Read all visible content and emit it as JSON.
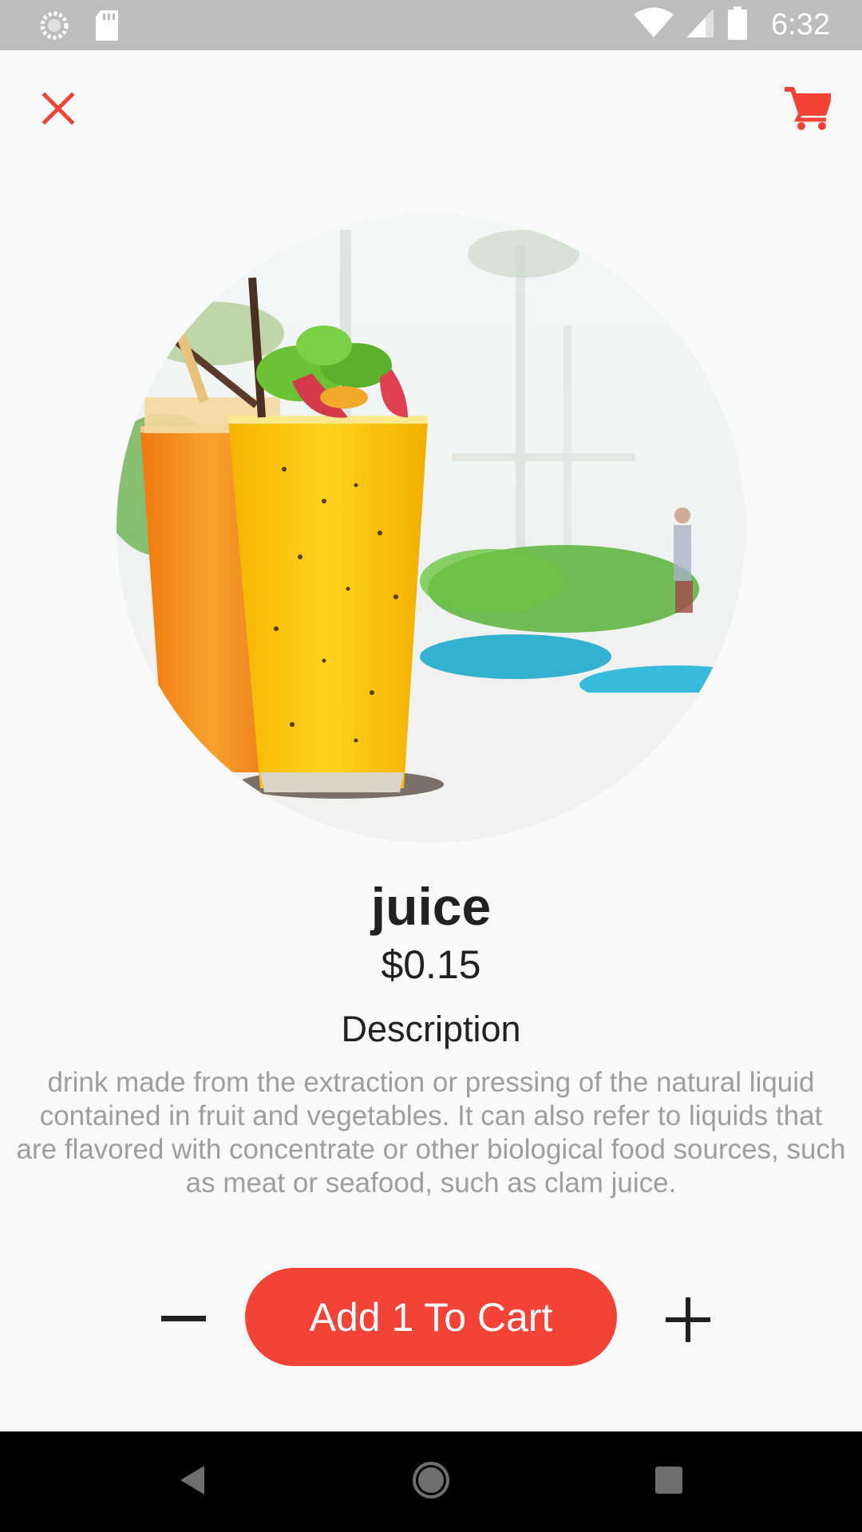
{
  "status_bar": {
    "time": "6:32",
    "left_icons": [
      "sync-icon",
      "sd-card-icon"
    ],
    "right_icons": [
      "wifi-icon",
      "signal-icon",
      "battery-icon"
    ]
  },
  "top_bar": {
    "close_icon": "close-icon",
    "cart_icon": "shopping-cart-icon"
  },
  "product": {
    "image_subject": "glasses of orange and mango juice",
    "name": "juice",
    "price": "$0.15",
    "description_heading": "Description",
    "description": "drink made from the extraction or pressing of the natural liquid contained in fruit and vegetables. It can also refer to liquids that are flavored with concentrate or other biological food sources, such as meat or seafood, such as clam juice."
  },
  "quantity_controls": {
    "decrement_icon": "minus-icon",
    "increment_icon": "plus-icon",
    "add_label": "Add 1 To Cart"
  },
  "nav_bar": {
    "icons": [
      "back-icon",
      "home-icon",
      "recents-icon"
    ]
  },
  "colors": {
    "accent": "#f44336",
    "status_bar": "#bdbdbd",
    "background": "#fafafa",
    "title_text": "#212121",
    "body_text": "#9e9e9e",
    "nav_bar": "#000000"
  }
}
